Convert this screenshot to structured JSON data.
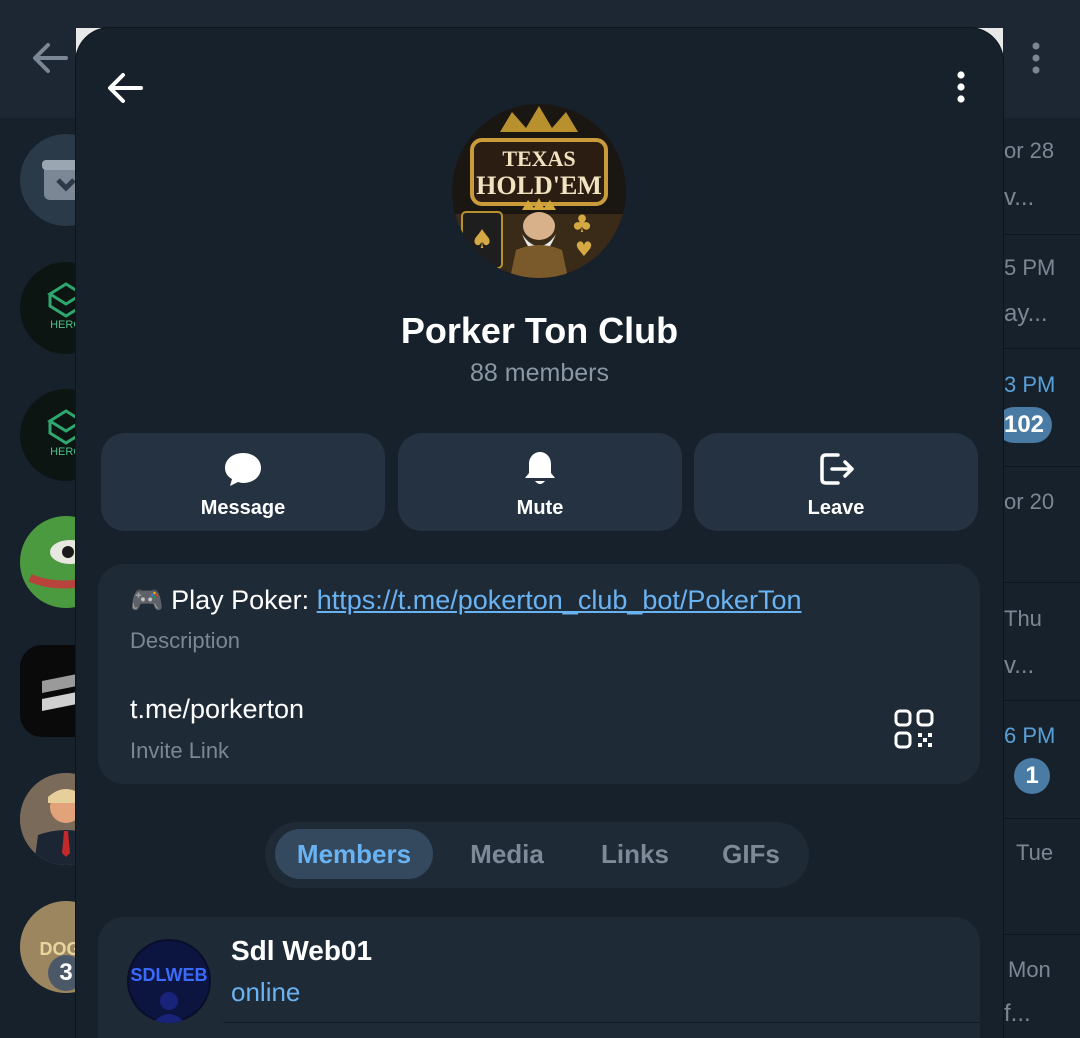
{
  "chat_list": {
    "times": [
      "or 28",
      "5 PM",
      "3 PM",
      "or 20",
      "Thu",
      "6 PM",
      "Tue",
      "Mon"
    ],
    "snippets": [
      "v...",
      "ay...",
      "v...",
      "f..."
    ],
    "badges": [
      "102",
      "1",
      "3"
    ],
    "avatar_labels": [
      "HERO",
      "HERO",
      "DOG"
    ]
  },
  "group": {
    "name": "Porker Ton Club",
    "members": "88 members",
    "avatar_text_top": "TEXAS",
    "avatar_text_bottom": "HOLD'EM"
  },
  "actions": {
    "message": "Message",
    "mute": "Mute",
    "leave": "Leave"
  },
  "info": {
    "description_prefix": "🎮 Play Poker: ",
    "description_link": "https://t.me/pokerton_club_bot/PokerTon",
    "description_label": "Description",
    "invite_link": "t.me/porkerton",
    "invite_label": "Invite Link"
  },
  "tabs": [
    "Members",
    "Media",
    "Links",
    "GIFs"
  ],
  "active_tab": "Members",
  "member": {
    "name": "Sdl Web01",
    "status": "online",
    "avatar_text": "SDLWEB"
  },
  "colors": {
    "background": "#17212b",
    "card": "#1f2a37",
    "button": "#253241",
    "accent": "#6ab3f3",
    "muted_text": "#8a97a4"
  },
  "icons": {
    "back": "arrow-left-icon",
    "more": "more-vertical-icon",
    "message": "chat-bubble-icon",
    "mute": "bell-icon",
    "leave": "logout-icon",
    "qr": "qr-code-icon"
  }
}
